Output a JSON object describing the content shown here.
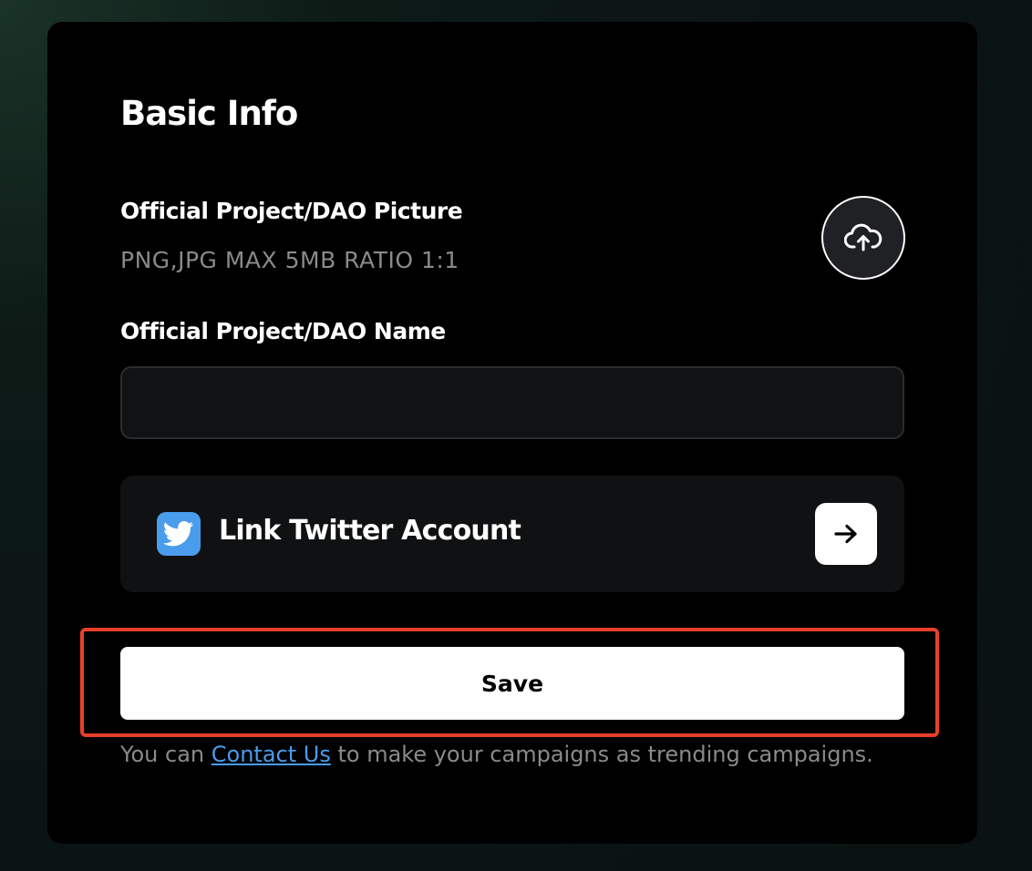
{
  "basic_info": {
    "title": "Basic Info",
    "picture": {
      "label": "Official Project/DAO Picture",
      "hint": "PNG,JPG MAX 5MB RATIO 1:1",
      "upload_icon": "cloud-upload-icon"
    },
    "name": {
      "label": "Official Project/DAO Name",
      "value": "",
      "placeholder": ""
    },
    "twitter": {
      "icon": "twitter-icon",
      "label": "Link Twitter Account",
      "action_icon": "arrow-right-icon"
    },
    "save_label": "Save",
    "footer": {
      "prefix": "You can",
      "link": "Contact Us",
      "suffix": "to make your campaigns as trending campaigns."
    }
  },
  "colors": {
    "card_background": "#000000",
    "accent_link": "#4a9cec",
    "twitter_brand": "#4a9cec",
    "highlight_border": "#e8402b",
    "muted_text": "#8a8a8a"
  }
}
